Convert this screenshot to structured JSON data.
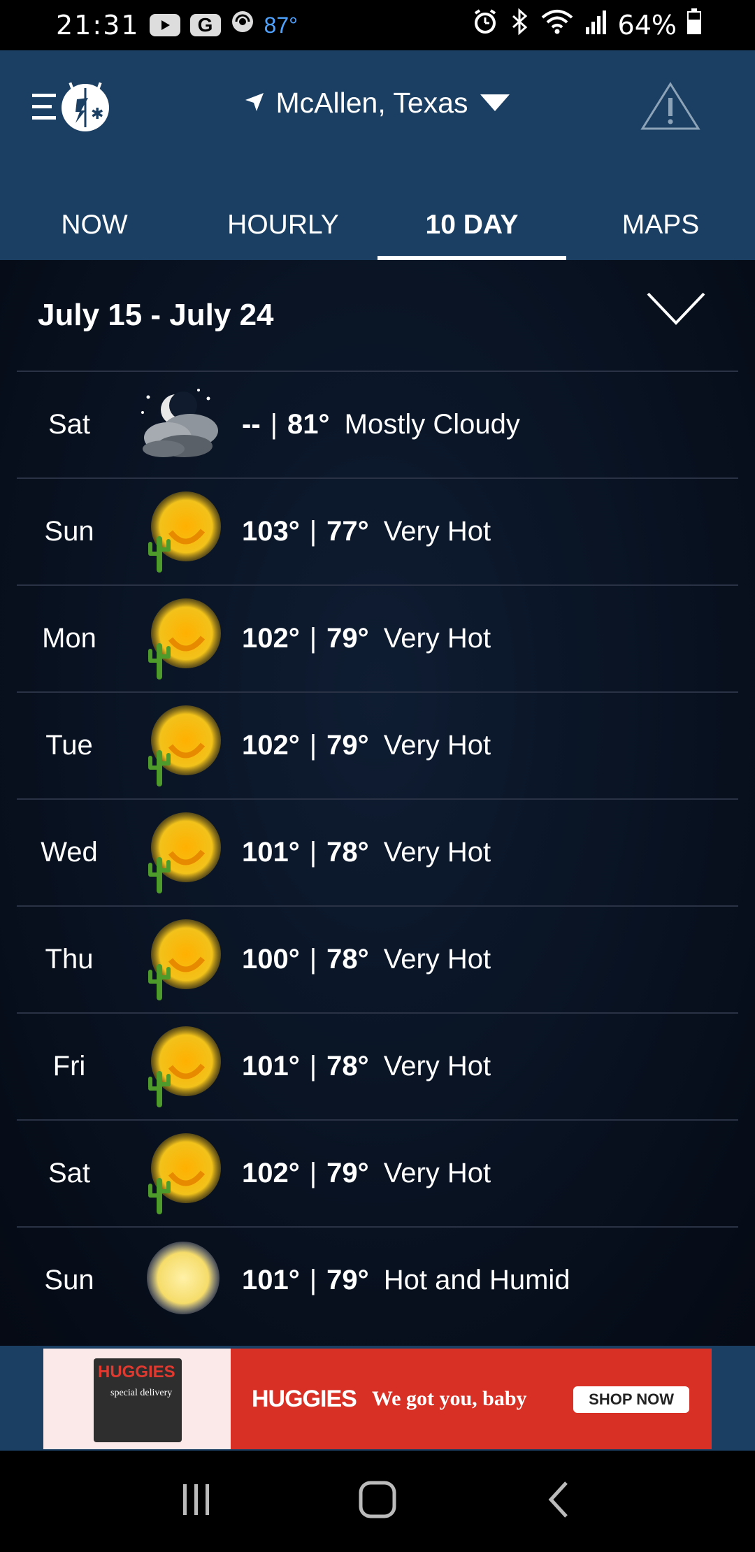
{
  "status_bar": {
    "time": "21:31",
    "notif_icons": [
      "youtube-icon",
      "google-icon",
      "hotspot-icon"
    ],
    "temperature": "87°",
    "right_icons": [
      "alarm-icon",
      "bluetooth-icon",
      "wifi-icon",
      "signal-icon"
    ],
    "battery": "64%"
  },
  "header": {
    "location": "McAllen, Texas",
    "tabs": [
      {
        "label": "NOW",
        "active": false
      },
      {
        "label": "HOURLY",
        "active": false
      },
      {
        "label": "10 DAY",
        "active": true
      },
      {
        "label": "MAPS",
        "active": false
      }
    ]
  },
  "range": {
    "title": "July 15 - July 24"
  },
  "forecast": [
    {
      "day": "Sat",
      "hi": "--",
      "lo": "81°",
      "condition": "Mostly Cloudy",
      "icon": "moon-cloud-icon"
    },
    {
      "day": "Sun",
      "hi": "103°",
      "lo": "77°",
      "condition": "Very Hot",
      "icon": "hot-sun-cactus-icon"
    },
    {
      "day": "Mon",
      "hi": "102°",
      "lo": "79°",
      "condition": "Very Hot",
      "icon": "hot-sun-cactus-icon"
    },
    {
      "day": "Tue",
      "hi": "102°",
      "lo": "79°",
      "condition": "Very Hot",
      "icon": "hot-sun-cactus-icon"
    },
    {
      "day": "Wed",
      "hi": "101°",
      "lo": "78°",
      "condition": "Very Hot",
      "icon": "hot-sun-cactus-icon"
    },
    {
      "day": "Thu",
      "hi": "100°",
      "lo": "78°",
      "condition": "Very Hot",
      "icon": "hot-sun-cactus-icon"
    },
    {
      "day": "Fri",
      "hi": "101°",
      "lo": "78°",
      "condition": "Very Hot",
      "icon": "hot-sun-cactus-icon"
    },
    {
      "day": "Sat",
      "hi": "102°",
      "lo": "79°",
      "condition": "Very Hot",
      "icon": "hot-sun-cactus-icon"
    },
    {
      "day": "Sun",
      "hi": "101°",
      "lo": "79°",
      "condition": "Hot and Humid",
      "icon": "hazy-sun-icon"
    }
  ],
  "ad": {
    "box_brand": "HUGGIES",
    "box_sub": "special delivery",
    "brand": "HUGGIES",
    "slogan": "We got you, baby",
    "cta": "SHOP NOW"
  },
  "colors": {
    "header_bg": "#1b3f63",
    "ad_red": "#d93025",
    "status_temp": "#4fa3ff",
    "sun_yellow": "#f2c21b"
  }
}
